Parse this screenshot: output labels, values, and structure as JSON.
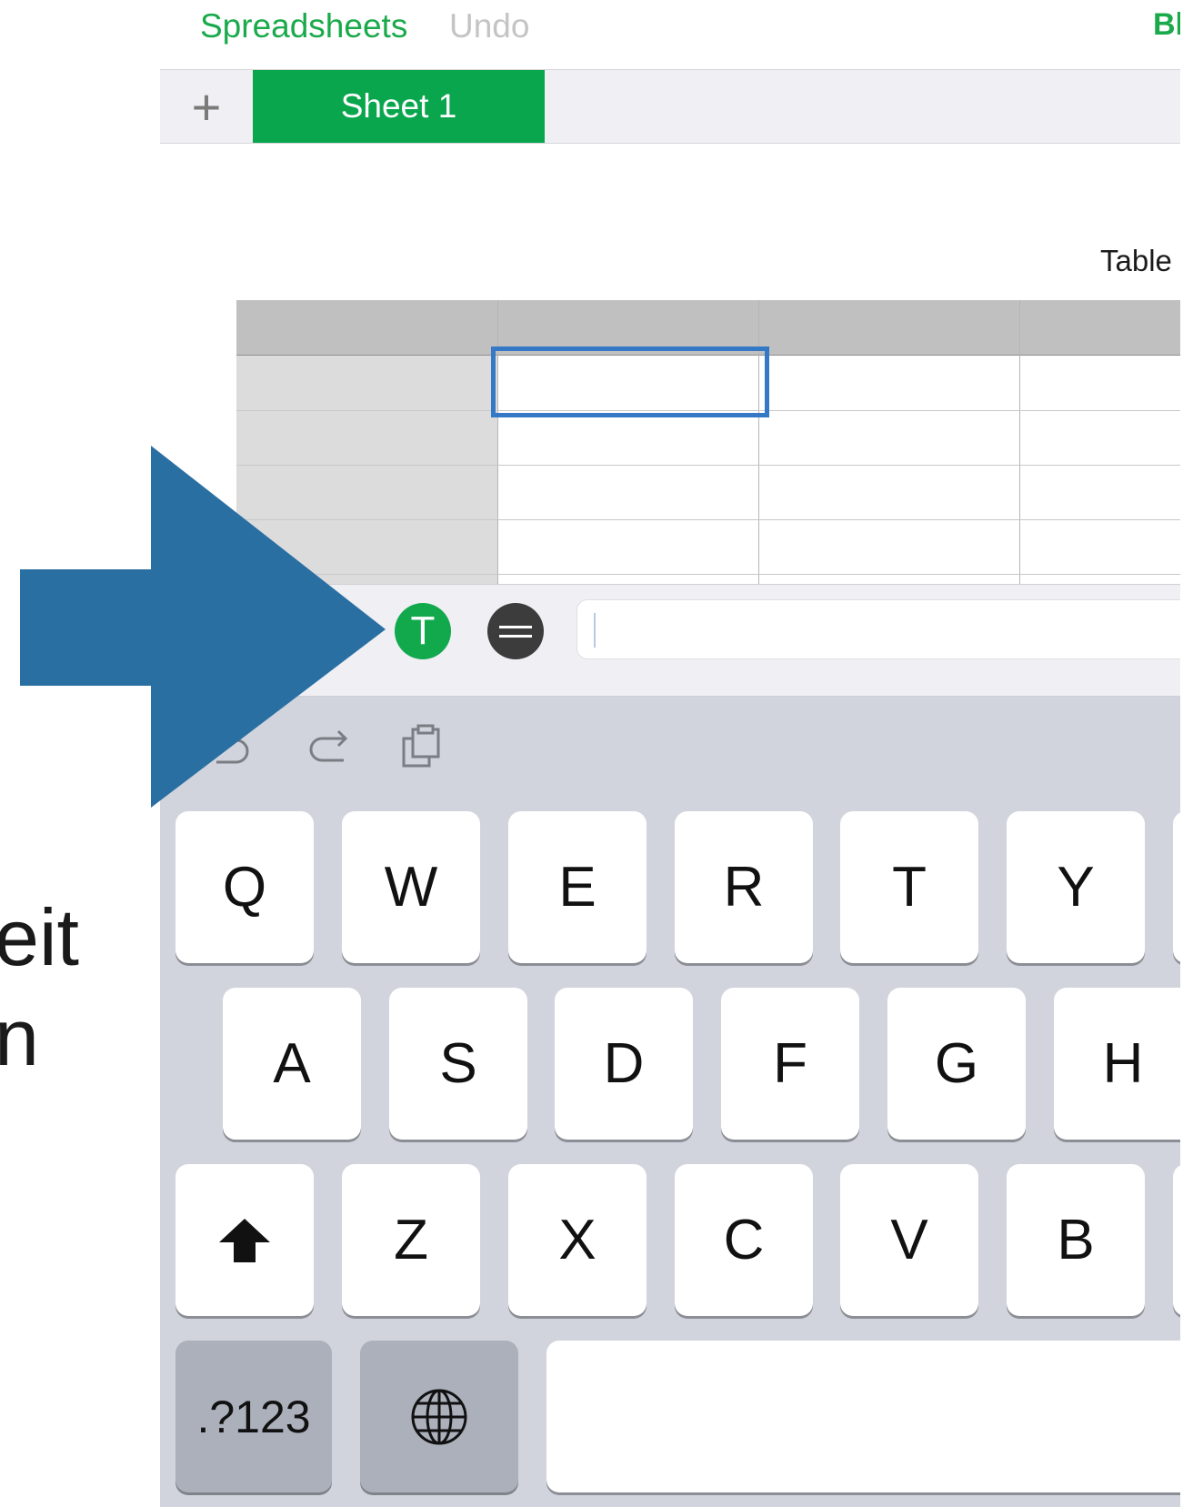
{
  "nav": {
    "back_label": "Spreadsheets",
    "undo_label": "Undo",
    "right_label": "Bl"
  },
  "sheets": {
    "add_glyph": "+",
    "active_tab": "Sheet 1"
  },
  "table": {
    "name": "Table"
  },
  "formula_bar": {
    "text_button_glyph": "T",
    "input_value": ""
  },
  "keyboard": {
    "toolbar_icons": [
      "undo-icon",
      "redo-icon",
      "paste-icon"
    ],
    "row1": [
      "Q",
      "W",
      "E",
      "R",
      "T",
      "Y"
    ],
    "row2": [
      "A",
      "S",
      "D",
      "F",
      "G",
      "H"
    ],
    "row3": [
      "Z",
      "X",
      "C",
      "V",
      "B"
    ],
    "shift_icon": "shift-icon",
    "numbers_label": ".?123",
    "globe_icon": "globe-icon",
    "space_label": ""
  },
  "annotation": {
    "side_text_1": "eit",
    "side_text_2": "n",
    "arrow_color": "#2a6fa2"
  }
}
